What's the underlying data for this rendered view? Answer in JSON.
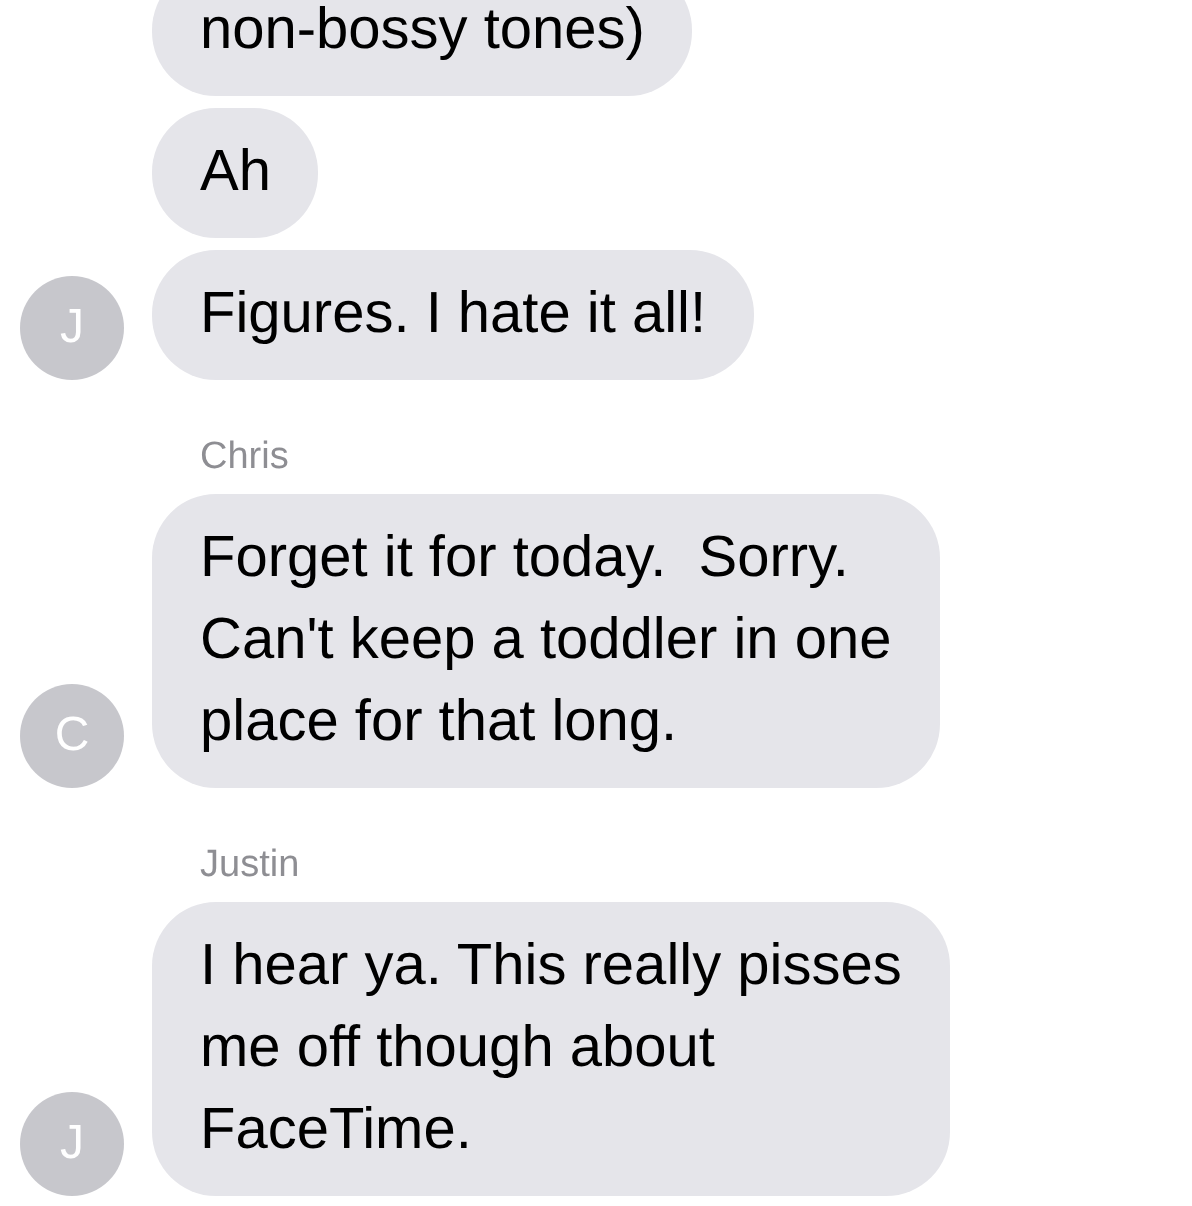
{
  "groups": [
    {
      "avatar": "J",
      "messages": [
        "non-bossy tones)",
        "Ah",
        "Figures. I hate it all!"
      ]
    },
    {
      "sender": "Chris",
      "avatar": "C",
      "messages": [
        "Forget it for today.  Sorry.\nCan't keep a toddler in one\nplace for that long."
      ]
    },
    {
      "sender": "Justin",
      "avatar": "J",
      "messages": [
        "I hear ya. This really pisses\nme off though about\nFaceTime."
      ]
    }
  ]
}
